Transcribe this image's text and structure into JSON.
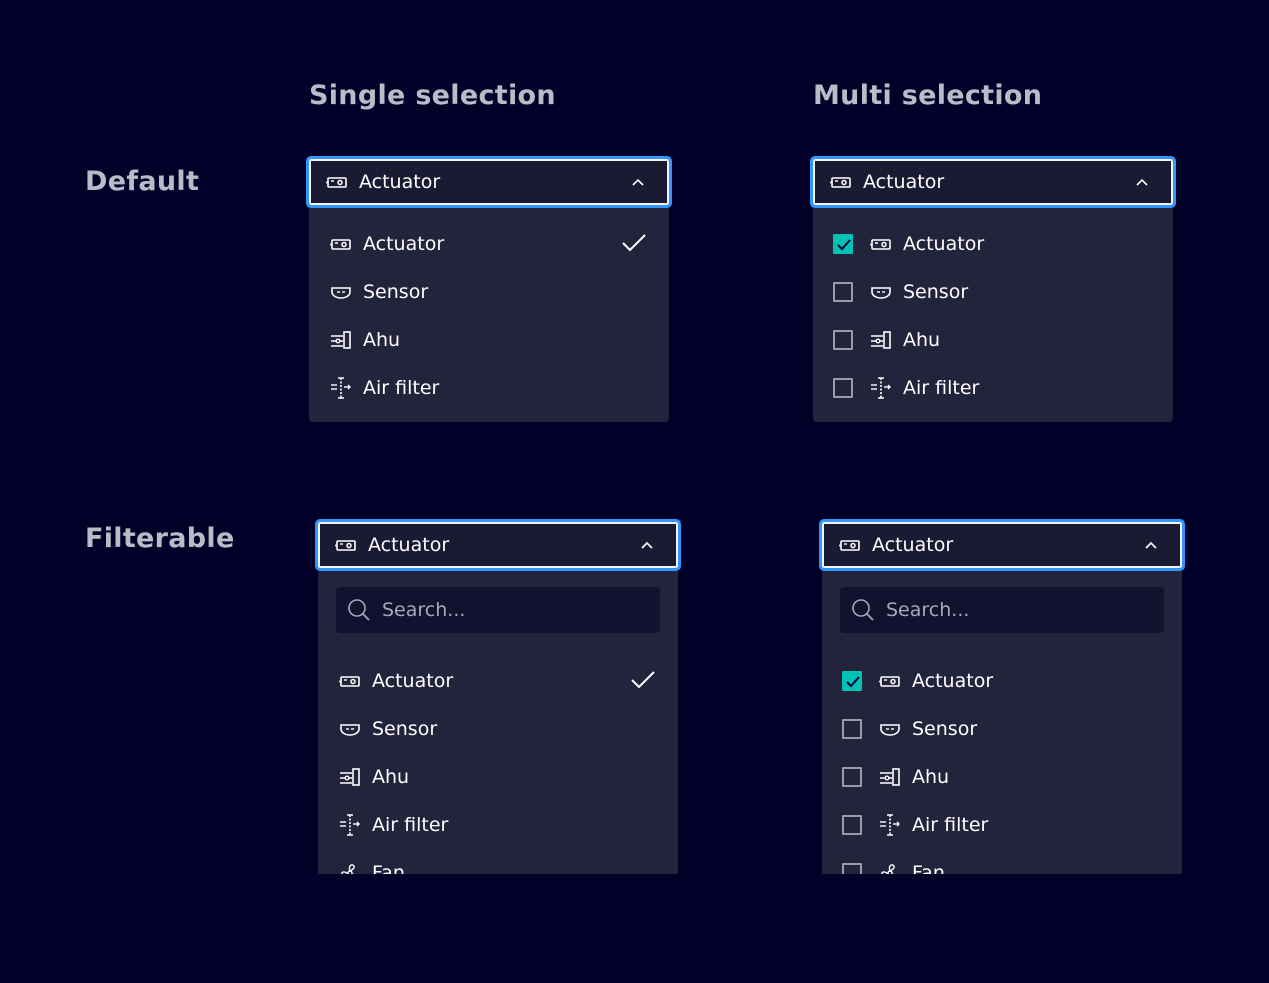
{
  "columns": {
    "single": "Single selection",
    "multi": "Multi selection"
  },
  "rows": {
    "default": "Default",
    "filterable": "Filterable"
  },
  "dropdown": {
    "selected_label": "Actuator",
    "selected_icon": "actuator-icon",
    "search_placeholder": "Search..."
  },
  "items_default": [
    {
      "label": "Actuator",
      "icon": "actuator-icon",
      "selected": true
    },
    {
      "label": "Sensor",
      "icon": "sensor-icon",
      "selected": false
    },
    {
      "label": "Ahu",
      "icon": "ahu-icon",
      "selected": false
    },
    {
      "label": "Air filter",
      "icon": "air-filter-icon",
      "selected": false
    }
  ],
  "items_filterable": [
    {
      "label": "Actuator",
      "icon": "actuator-icon",
      "selected": true
    },
    {
      "label": "Sensor",
      "icon": "sensor-icon",
      "selected": false
    },
    {
      "label": "Ahu",
      "icon": "ahu-icon",
      "selected": false
    },
    {
      "label": "Air filter",
      "icon": "air-filter-icon",
      "selected": false
    },
    {
      "label": "Fan",
      "icon": "fan-icon",
      "selected": false
    }
  ],
  "colors": {
    "background": "#000028",
    "menu": "#23233c",
    "focus_outline": "#3296ff",
    "checkbox_checked": "#00c1b6",
    "heading": "#b9bcc6"
  }
}
